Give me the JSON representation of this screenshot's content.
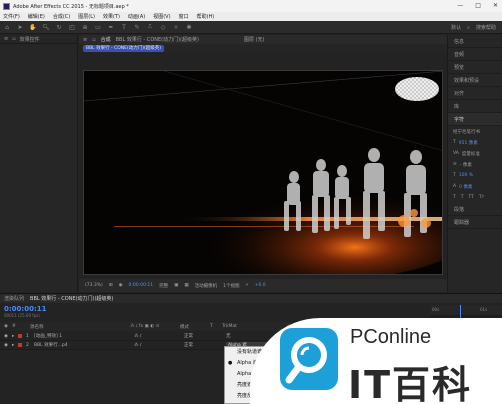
{
  "titlebar": {
    "title": "Adobe After Effects CC 2015 - 无标题项目.aep *",
    "min": "—",
    "max": "□",
    "close": "✕"
  },
  "menu": [
    "文件(F)",
    "编辑(E)",
    "合成(C)",
    "图层(L)",
    "效果(T)",
    "动画(A)",
    "视图(V)",
    "窗口",
    "帮助(H)"
  ],
  "toolbar": {
    "workspace": "默认",
    "search": "搜索帮助"
  },
  "left_panel": {
    "tab": "效果控件",
    "tab_icon": "lock-icon"
  },
  "composition": {
    "tab_label": "合成",
    "tab_name": "BBL 效果行 - CONE(动力门)(超级英)",
    "layer_tab": "图层 (无)",
    "pill": "BBL 效果行 - CONE(动力门)(超级英)",
    "zoom": "(73.3%)",
    "timecode": "0:00:00:11",
    "quality": "完整",
    "camera": "活动摄像机",
    "views": "1个视图",
    "offset": "+0.0"
  },
  "right_panel": {
    "items": [
      "信息",
      "音频",
      "预览",
      "效果和预设",
      "对齐",
      "库"
    ],
    "character_section": "字符",
    "font": "经宁毛笔行书",
    "char_rows": [
      {
        "label": "T",
        "value": "951 像素"
      },
      {
        "label": "VA",
        "value": "度量标准"
      },
      {
        "label": "≡",
        "value": "- 像素"
      },
      {
        "label": "T",
        "value": "100 %"
      },
      {
        "label": "A",
        "value": "0 像素"
      }
    ],
    "lower_items": [
      "段落",
      "跟踪器"
    ]
  },
  "timeline": {
    "tabs": [
      "渲染队列",
      "BBL 效果行 - CONE(动力门)(超级英)"
    ],
    "time": "0:00:00:11",
    "fps": "00011 (25.00 fps)",
    "columns": [
      "#",
      "源名称",
      "模式",
      "T",
      "TrkMat",
      "父级"
    ],
    "layers": [
      {
        "num": "1",
        "name": "[动画_特效] 1",
        "mode": "正常",
        "trk": "无",
        "color": "#c0392b"
      },
      {
        "num": "2",
        "name": "BBL 效果行...p4",
        "mode": "正常",
        "trk": "Alpha 遮",
        "color": "#c0392b"
      }
    ],
    "ruler_labels": [
      "00s",
      "01s"
    ]
  },
  "dropdown": {
    "items": [
      "没有轨道遮罩",
      "Alpha 遮罩",
      "Alpha 反转遮罩",
      "亮度遮罩",
      "亮度反转遮罩"
    ],
    "selected_index": 1
  },
  "watermark": {
    "line1": "PConline",
    "line2": "IT百科"
  }
}
